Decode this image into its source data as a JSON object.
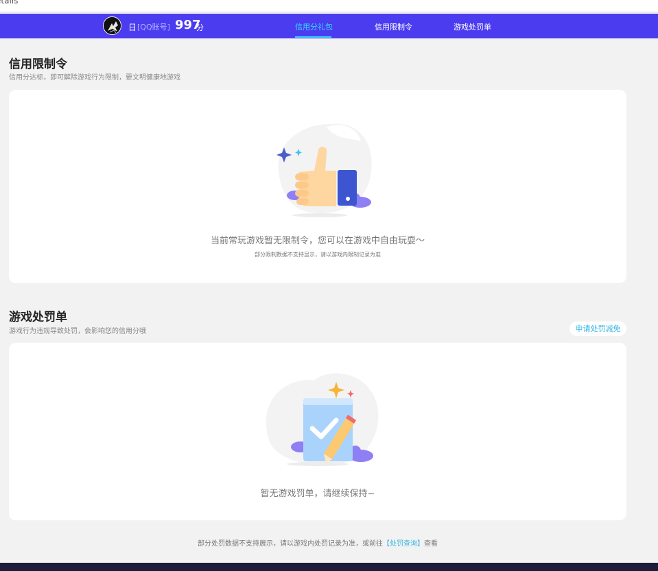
{
  "window": {
    "clipped_title": "etails"
  },
  "header": {
    "user_name": "日",
    "account_type": "[QQ账号]",
    "score": "997",
    "score_unit": "分",
    "tabs": [
      {
        "label": "信用分礼包",
        "active": true
      },
      {
        "label": "信用限制令",
        "active": false
      },
      {
        "label": "游戏处罚单",
        "active": false
      }
    ]
  },
  "restriction": {
    "title": "信用限制令",
    "subtitle": "信用分达标，即可解除游戏行为限制，要文明健康地游戏",
    "empty_message": "当前常玩游戏暂无限制令，您可以在游戏中自由玩耍～",
    "note": "部分限制数据不支持显示，请以游戏内限制记录为准"
  },
  "penalty": {
    "title": "游戏处罚单",
    "subtitle": "游戏行为违规导致处罚，会影响您的信用分哦",
    "appeal_button": "申请处罚减免",
    "empty_message": "暂无游戏罚单，请继续保持~"
  },
  "footer": {
    "note_prefix": "部分处罚数据不支持展示，请以游戏内处罚记录为准，或前往",
    "link_text": "【处罚查询】",
    "note_suffix": "查看"
  },
  "colors": {
    "nav_bg": "#4b3cf0",
    "accent": "#37d9ff",
    "link": "#35b6e6",
    "page_bg": "#f2f2f2"
  }
}
